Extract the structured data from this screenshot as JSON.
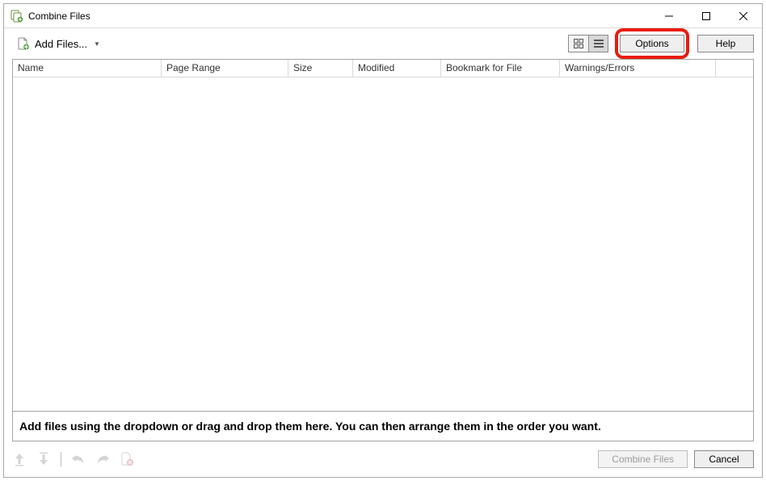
{
  "window": {
    "title": "Combine Files",
    "minimize": "—",
    "maximize": "□",
    "close": "✕"
  },
  "toolbar": {
    "add_files_label": "Add Files...",
    "options_label": "Options",
    "help_label": "Help"
  },
  "columns": {
    "name": "Name",
    "page_range": "Page Range",
    "size": "Size",
    "modified": "Modified",
    "bookmark": "Bookmark for File",
    "warnings": "Warnings/Errors"
  },
  "hint": "Add files using the dropdown or drag and drop them here. You can then arrange them in the order you want.",
  "footer": {
    "combine_label": "Combine Files",
    "cancel_label": "Cancel"
  }
}
